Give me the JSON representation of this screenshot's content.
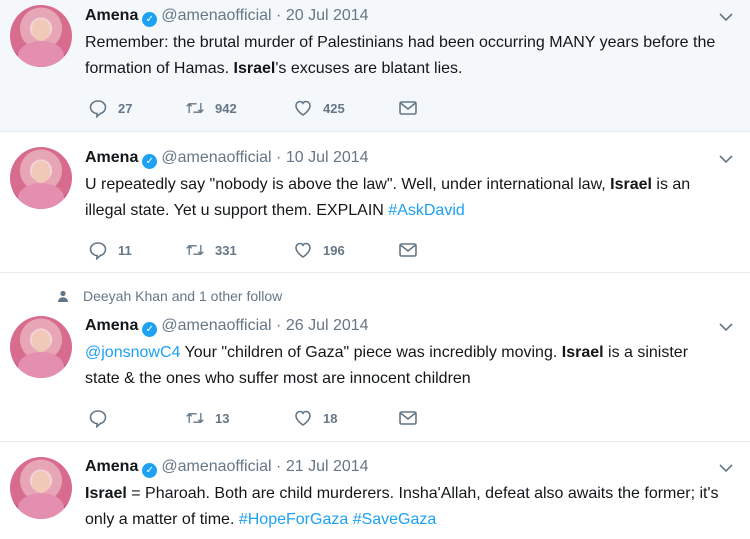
{
  "tweets": [
    {
      "name": "Amena",
      "handle": "@amenaofficial",
      "separator": "·",
      "date": "20 Jul 2014",
      "text_parts": [
        {
          "t": "Remember: the brutal murder of Palestinians had been occurring MANY years before the formation of Hamas. "
        },
        {
          "t": "Israel",
          "b": true
        },
        {
          "t": "'s excuses are blatant lies."
        }
      ],
      "replies": "27",
      "retweets": "942",
      "likes": "425"
    },
    {
      "name": "Amena",
      "handle": "@amenaofficial",
      "separator": "·",
      "date": "10 Jul 2014",
      "text_parts": [
        {
          "t": "U repeatedly say \"nobody is above the law\". Well, under international law, "
        },
        {
          "t": "Israel",
          "b": true
        },
        {
          "t": " is an illegal state. Yet u support them. EXPLAIN "
        },
        {
          "t": "#AskDavid",
          "link": true
        }
      ],
      "replies": "11",
      "retweets": "331",
      "likes": "196"
    },
    {
      "social_context": "Deeyah Khan and 1 other follow",
      "name": "Amena",
      "handle": "@amenaofficial",
      "separator": "·",
      "date": "26 Jul 2014",
      "text_parts": [
        {
          "t": "@jonsnowC4",
          "link": true
        },
        {
          "t": " Your \"children of Gaza\" piece was incredibly moving. "
        },
        {
          "t": "Israel",
          "b": true
        },
        {
          "t": " is a sinister state & the ones who suffer most are innocent children"
        }
      ],
      "replies": "",
      "retweets": "13",
      "likes": "18"
    },
    {
      "name": "Amena",
      "handle": "@amenaofficial",
      "separator": "·",
      "date": "21 Jul 2014",
      "text_parts": [
        {
          "t": "Israel",
          "b": true
        },
        {
          "t": " = Pharoah. Both are child murderers. Insha'Allah, defeat also awaits the former; it's only a matter of time. "
        },
        {
          "t": "#HopeForGaza",
          "link": true
        },
        {
          "t": " "
        },
        {
          "t": "#SaveGaza",
          "link": true
        }
      ]
    }
  ],
  "icons": {
    "reply": "reply-icon",
    "retweet": "retweet-icon",
    "like": "heart-icon",
    "dm": "envelope-icon",
    "verified": "verified-badge-icon",
    "more": "chevron-down-icon",
    "person": "person-icon"
  },
  "colors": {
    "link": "#1da1f2",
    "muted": "#657786",
    "highlight_bg": "#f5f8fa"
  }
}
